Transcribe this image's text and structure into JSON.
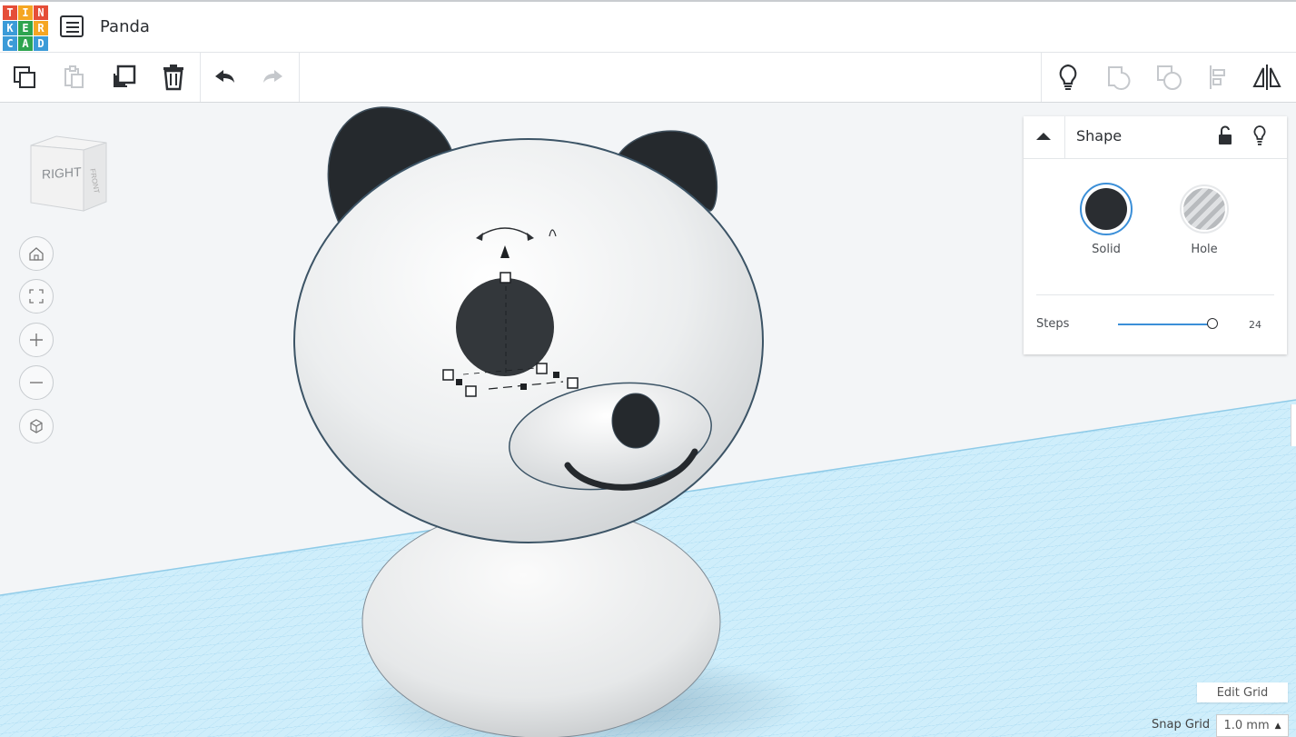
{
  "app": {
    "logo_letters": [
      "T",
      "I",
      "N",
      "K",
      "E",
      "R",
      "C",
      "A",
      "D"
    ],
    "logo_colors": [
      "#e54e38",
      "#f5a623",
      "#e54e38",
      "#3b9bd8",
      "#2ea44f",
      "#f5a623",
      "#3b9bd8",
      "#2ea44f",
      "#3b9bd8"
    ],
    "design_title": "Panda"
  },
  "toolbar": {
    "left_icons": [
      "copy-icon",
      "paste-icon",
      "duplicate-icon",
      "delete-icon",
      "undo-icon",
      "redo-icon"
    ],
    "right_icons": [
      "note-icon",
      "group-icon",
      "ungroup-icon",
      "align-icon",
      "mirror-icon"
    ]
  },
  "viewcube": {
    "face_label": "RIGHT",
    "side_label": "FRONT"
  },
  "nav_controls": [
    "home-view",
    "fit-view",
    "zoom-in",
    "zoom-out",
    "ortho-view"
  ],
  "shape_panel": {
    "title": "Shape",
    "solid_label": "Solid",
    "hole_label": "Hole",
    "solid_color": "#2a2d31",
    "steps_label": "Steps",
    "steps_value": "24",
    "steps_fraction": 1.0
  },
  "grid": {
    "edit_grid_label": "Edit Grid",
    "snap_grid_label": "Snap Grid",
    "snap_grid_value": "1.0 mm"
  }
}
